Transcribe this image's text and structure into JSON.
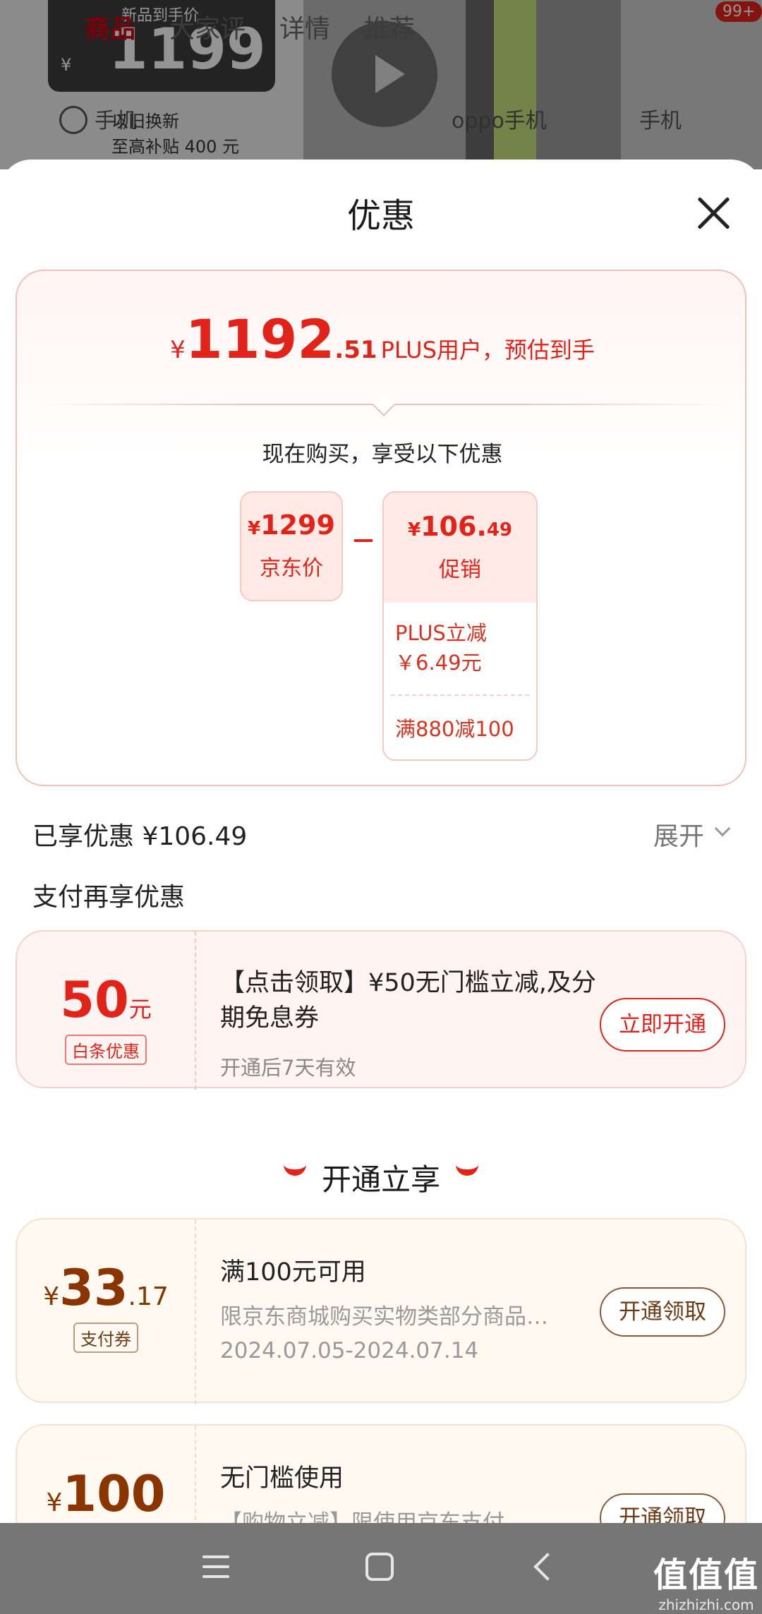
{
  "background": {
    "tabs": [
      "商品",
      "大家评",
      "详情",
      "推荐"
    ],
    "badge": "99+",
    "price_tag_label": "新品到手价",
    "price_tag_yen": "¥",
    "price_tag_value": "1199",
    "trade_in_line1": "以旧换新",
    "trade_in_line2": "至高补贴 400 元",
    "sub_items": [
      "手机",
      "oppo手机",
      "手机"
    ]
  },
  "sheet": {
    "title": "优惠"
  },
  "estimate": {
    "currency": "¥",
    "integer": "1192",
    "decimal": ".51",
    "description": "PLUS用户，预估到手"
  },
  "breakdown": {
    "hint": "现在购买，享受以下优惠",
    "jd_price": {
      "currency": "¥",
      "value": "1299",
      "label": "京东价"
    },
    "promo": {
      "currency": "¥",
      "value": "106.",
      "value_small": "49",
      "label": "促销",
      "detail_1_line1": "PLUS立减",
      "detail_1_line2": "￥6.49元",
      "detail_2": "满880减100"
    }
  },
  "enjoyed": {
    "text": "已享优惠 ¥106.49",
    "expand_label": "展开"
  },
  "pay_section_title": "支付再享优惠",
  "baitiao": {
    "amount": "50",
    "unit": "元",
    "tag": "白条优惠",
    "title": "【点击领取】¥50无门槛立减,及分期免息券",
    "subtitle": "开通后7天有效",
    "button": "立即开通"
  },
  "open_enjoy_title": "开通立享",
  "coupons": [
    {
      "currency": "¥",
      "integer": "33",
      "decimal": ".17",
      "tag": "支付券",
      "title": "满100元可用",
      "desc": "限京东商城购买实物类部分商品…",
      "date": "2024.07.05-2024.07.14",
      "button": "开通领取"
    },
    {
      "currency": "¥",
      "integer": "100",
      "decimal": "",
      "title": "无门槛使用",
      "desc": "【购物立减】限使用京东支付",
      "button": "开通领取"
    }
  ],
  "watermark": {
    "main": "值值值",
    "sub": "zhizhizhi.com"
  },
  "colors": {
    "accent_red": "#e2231a",
    "coupon_brown": "#8a3500",
    "nav_bar": "#767676"
  },
  "icons": [
    "close-icon",
    "chevron-down-icon",
    "smile-icon",
    "menu-icon",
    "home-icon",
    "back-icon",
    "play-icon"
  ]
}
